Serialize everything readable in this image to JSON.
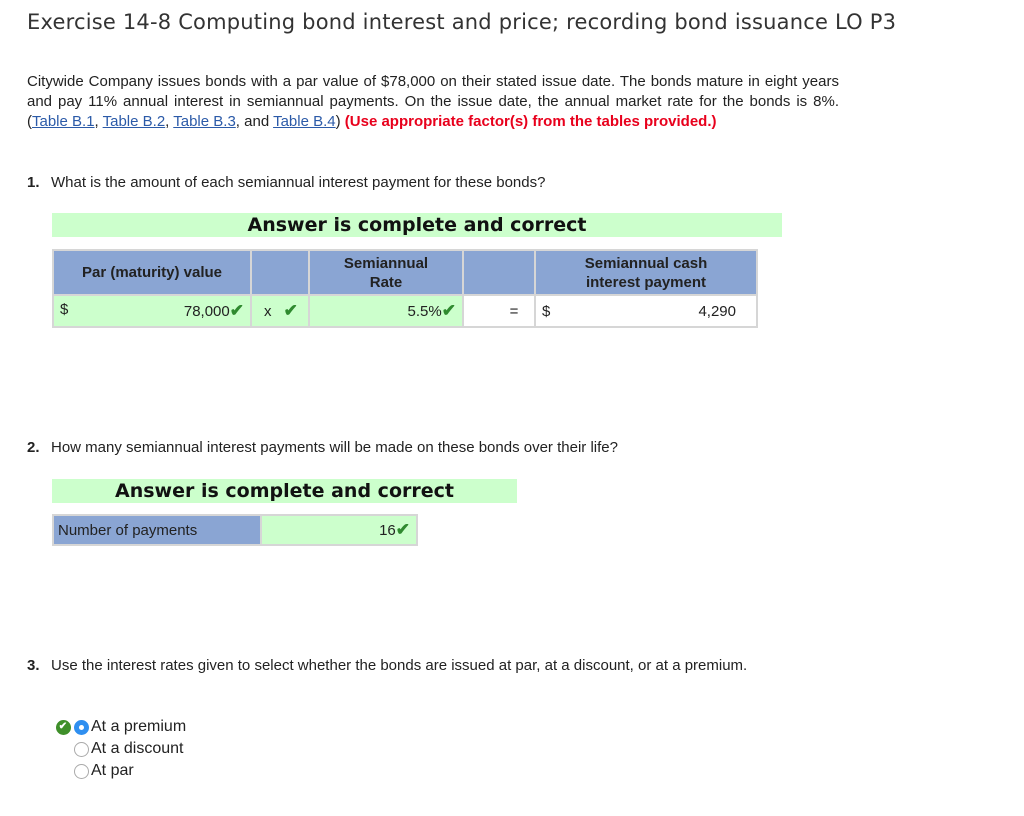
{
  "title": "Exercise 14-8 Computing bond interest and price; recording bond issuance LO P3",
  "intro": {
    "text_before": "Citywide Company issues bonds with a par value of $78,000 on their stated issue date. The bonds mature in eight years and pay 11% annual interest in semiannual payments. On the issue date, the annual market rate for the bonds is 8%. (",
    "links": [
      "Table B.1",
      "Table B.2",
      "Table B.3",
      "Table B.4"
    ],
    "sep1": ", ",
    "sep2": ", ",
    "sep3": ", and ",
    "close_paren": ") ",
    "instruction": "(Use appropriate factor(s) from the tables provided.)"
  },
  "q1": {
    "number": "1.",
    "text": "What is the amount of each semiannual interest payment for these bonds?",
    "banner": "Answer is complete and correct",
    "headers": [
      "Par (maturity) value",
      "",
      "Semiannual Rate",
      "",
      "Semiannual cash interest payment"
    ],
    "row": {
      "par_currency": "$",
      "par_value": "78,000",
      "operator": "x",
      "rate": "5.5%",
      "equals": "=",
      "payment_currency": "$",
      "payment": "4,290",
      "check": "✔"
    }
  },
  "q2": {
    "number": "2.",
    "text": "How many semiannual interest payments will be made on these bonds over their life?",
    "banner": "Answer is complete and correct",
    "label": "Number of payments",
    "value": "16",
    "check": "✔"
  },
  "q3": {
    "number": "3.",
    "text": "Use the interest rates given to select whether the bonds are issued at par, at a discount, or at a premium.",
    "options": [
      {
        "label": "At a premium",
        "selected": true,
        "correct": true
      },
      {
        "label": "At a discount",
        "selected": false,
        "correct": false
      },
      {
        "label": "At par",
        "selected": false,
        "correct": false
      }
    ],
    "correct_icon": "✔"
  }
}
